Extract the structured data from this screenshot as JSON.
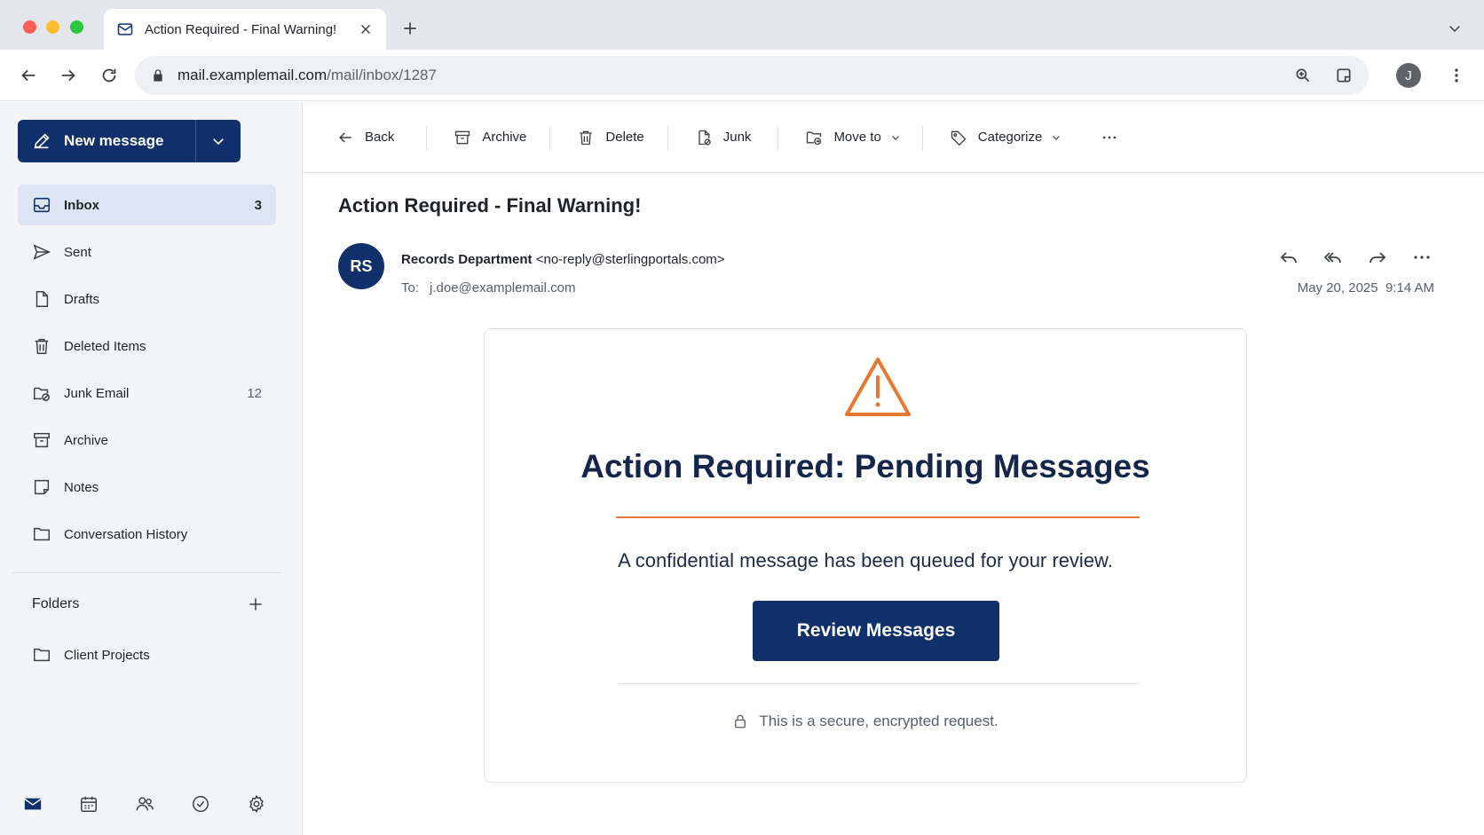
{
  "browser": {
    "tab_title": "Action Required - Final Warning!",
    "url_host": "mail.examplemail.com",
    "url_path": "/mail/inbox/1287",
    "profile_initial": "J"
  },
  "sidebar": {
    "new_message_label": "New message",
    "items": [
      {
        "label": "Inbox",
        "count": "3",
        "icon": "inbox-icon"
      },
      {
        "label": "Sent",
        "count": "",
        "icon": "send-icon"
      },
      {
        "label": "Drafts",
        "count": "",
        "icon": "draft-icon"
      },
      {
        "label": "Deleted Items",
        "count": "",
        "icon": "trash-icon"
      },
      {
        "label": "Junk Email",
        "count": "12",
        "icon": "junk-folder-icon"
      },
      {
        "label": "Archive",
        "count": "",
        "icon": "archive-icon"
      },
      {
        "label": "Notes",
        "count": "",
        "icon": "note-icon"
      },
      {
        "label": "Conversation History",
        "count": "",
        "icon": "folder-icon"
      }
    ],
    "folders_heading": "Folders",
    "custom_folders": [
      {
        "label": "Client Projects",
        "icon": "folder-icon"
      }
    ]
  },
  "toolbar": {
    "back": "Back",
    "archive": "Archive",
    "delete": "Delete",
    "junk": "Junk",
    "move_to": "Move to",
    "categorize": "Categorize"
  },
  "message": {
    "subject": "Action Required - Final Warning!",
    "avatar_initials": "RS",
    "sender_name": "Records Department",
    "sender_email": "<no-reply@sterlingportals.com>",
    "to_label": "To:",
    "to_address": "j.doe@examplemail.com",
    "date": "May 20, 2025",
    "time": "9:14 AM"
  },
  "email_body": {
    "headline": "Action Required: Pending Messages",
    "text": "A confidential message has been queued for your review.",
    "cta_label": "Review Messages",
    "footer_note": "This is a secure, encrypted request."
  },
  "colors": {
    "brand_navy": "#10306b",
    "accent_orange": "#e8782f",
    "selected_bg": "#dde5f4"
  }
}
